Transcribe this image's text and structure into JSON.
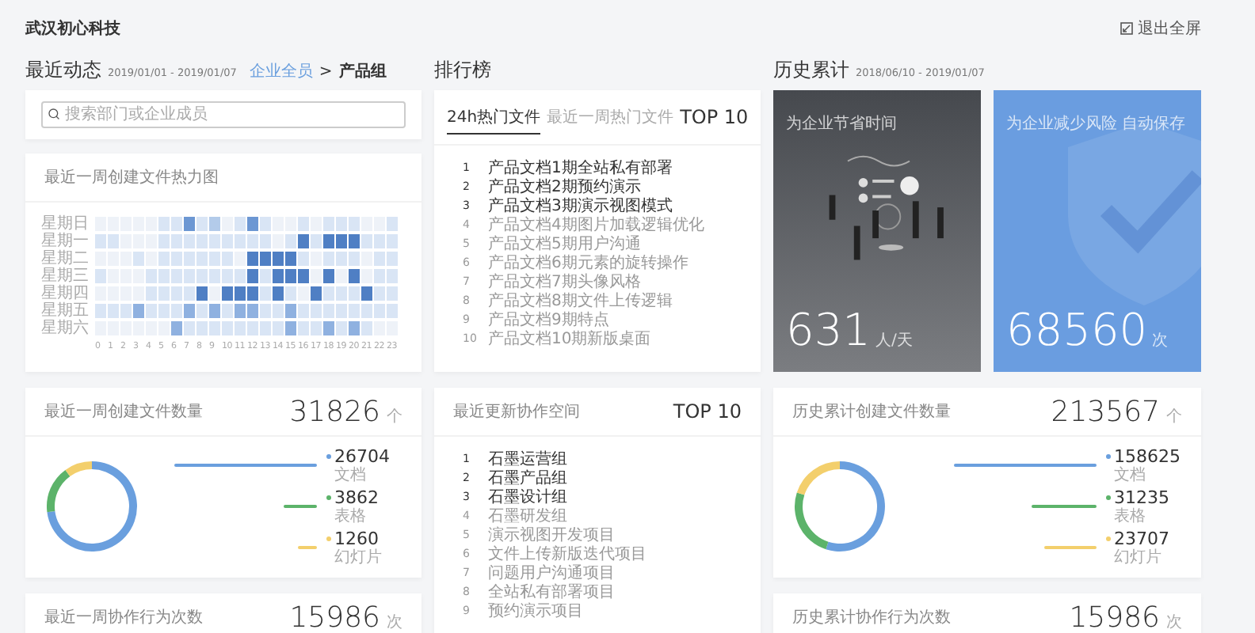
{
  "header": {
    "brand": "武汉初心科技",
    "exit_button": "退出全屏"
  },
  "recent": {
    "title": "最近动态",
    "date_range": "2019/01/01 - 2019/01/07",
    "breadcrumb": [
      {
        "label": "企业全员",
        "kind": "link"
      },
      {
        "label": ">",
        "kind": "separator"
      },
      {
        "label": "产品组",
        "kind": "current"
      }
    ],
    "search": {
      "placeholder": "搜索部门或企业成员"
    },
    "heatmap": {
      "title": "最近一周创建文件热力图",
      "hours": [
        "0",
        "1",
        "2",
        "3",
        "4",
        "5",
        "6",
        "7",
        "8",
        "9",
        "10",
        "11",
        "12",
        "13",
        "14",
        "15",
        "16",
        "17",
        "18",
        "19",
        "20",
        "21",
        "22",
        "23"
      ],
      "rows": [
        {
          "label": "星期日",
          "cells": [
            {
              "color": "#eef2f8"
            },
            {
              "color": "#eef2f8"
            },
            {
              "color": "#eef2f8"
            },
            {
              "color": "#eef2f8"
            },
            {
              "color": "#eef2f8"
            },
            {
              "color": "#d9e5f5"
            },
            {
              "color": "#d9e5f5"
            },
            {
              "color": "#6c97d3"
            },
            {
              "color": "#d9e5f5"
            },
            {
              "color": "#b3cbea"
            },
            {
              "color": "#eef2f8"
            },
            {
              "color": "#d9e5f5"
            },
            {
              "color": "#6c97d3"
            },
            {
              "color": "#d9e5f5"
            },
            {
              "color": "#eef2f8"
            },
            {
              "color": "#eef2f8"
            },
            {
              "color": "#d9e5f5"
            },
            {
              "color": "#eef2f8"
            },
            {
              "color": "#d9e5f5"
            },
            {
              "color": "#d9e5f5"
            },
            {
              "color": "#d9e5f5"
            },
            {
              "color": "#eef2f8"
            },
            {
              "color": "#eef2f8"
            },
            {
              "color": "#d9e5f5"
            }
          ]
        },
        {
          "label": "星期一",
          "cells": [
            {
              "color": "#d9e5f5"
            },
            {
              "color": "#d9e5f5"
            },
            {
              "color": "#eef2f8"
            },
            {
              "color": "#eef2f8"
            },
            {
              "color": "#eef2f8"
            },
            {
              "color": "#d9e5f5"
            },
            {
              "color": "#d9e5f5"
            },
            {
              "color": "#d9e5f5"
            },
            {
              "color": "#d9e5f5"
            },
            {
              "color": "#d9e5f5"
            },
            {
              "color": "#d9e5f5"
            },
            {
              "color": "#d9e5f5"
            },
            {
              "color": "#d9e5f5"
            },
            {
              "color": "#d9e5f5"
            },
            {
              "color": "#eef2f8"
            },
            {
              "color": "#d9e5f5"
            },
            {
              "color": "#4f7fc4"
            },
            {
              "color": "#d9e5f5"
            },
            {
              "color": "#4f7fc4"
            },
            {
              "color": "#4f7fc4"
            },
            {
              "color": "#4f7fc4"
            },
            {
              "color": "#d9e5f5"
            },
            {
              "color": "#d9e5f5"
            },
            {
              "color": "#d9e5f5"
            }
          ]
        },
        {
          "label": "星期二",
          "cells": [
            {
              "color": "#eef2f8"
            },
            {
              "color": "#eef2f8"
            },
            {
              "color": "#eef2f8"
            },
            {
              "color": "#d9e5f5"
            },
            {
              "color": "#eef2f8"
            },
            {
              "color": "#d9e5f5"
            },
            {
              "color": "#d9e5f5"
            },
            {
              "color": "#d9e5f5"
            },
            {
              "color": "#d9e5f5"
            },
            {
              "color": "#d9e5f5"
            },
            {
              "color": "#d9e5f5"
            },
            {
              "color": "#eef2f8"
            },
            {
              "color": "#4f7fc4"
            },
            {
              "color": "#4f7fc4"
            },
            {
              "color": "#4f7fc4"
            },
            {
              "color": "#4f7fc4"
            },
            {
              "color": "#d9e5f5"
            },
            {
              "color": "#eef2f8"
            },
            {
              "color": "#d9e5f5"
            },
            {
              "color": "#d9e5f5"
            },
            {
              "color": "#d9e5f5"
            },
            {
              "color": "#eef2f8"
            },
            {
              "color": "#d9e5f5"
            },
            {
              "color": "#d9e5f5"
            }
          ]
        },
        {
          "label": "星期三",
          "cells": [
            {
              "color": "#d9e5f5"
            },
            {
              "color": "#eef2f8"
            },
            {
              "color": "#eef2f8"
            },
            {
              "color": "#eef2f8"
            },
            {
              "color": "#d9e5f5"
            },
            {
              "color": "#d9e5f5"
            },
            {
              "color": "#d9e5f5"
            },
            {
              "color": "#d9e5f5"
            },
            {
              "color": "#d9e5f5"
            },
            {
              "color": "#d9e5f5"
            },
            {
              "color": "#d9e5f5"
            },
            {
              "color": "#d9e5f5"
            },
            {
              "color": "#4f7fc4"
            },
            {
              "color": "#d9e5f5"
            },
            {
              "color": "#4f7fc4"
            },
            {
              "color": "#4f7fc4"
            },
            {
              "color": "#4f7fc4"
            },
            {
              "color": "#eef2f8"
            },
            {
              "color": "#4f7fc4"
            },
            {
              "color": "#eef2f8"
            },
            {
              "color": "#4f7fc4"
            },
            {
              "color": "#eef2f8"
            },
            {
              "color": "#d9e5f5"
            },
            {
              "color": "#d9e5f5"
            }
          ]
        },
        {
          "label": "星期四",
          "cells": [
            {
              "color": "#eef2f8"
            },
            {
              "color": "#eef2f8"
            },
            {
              "color": "#eef2f8"
            },
            {
              "color": "#eef2f8"
            },
            {
              "color": "#d9e5f5"
            },
            {
              "color": "#d9e5f5"
            },
            {
              "color": "#d9e5f5"
            },
            {
              "color": "#d9e5f5"
            },
            {
              "color": "#4f7fc4"
            },
            {
              "color": "#eef2f8"
            },
            {
              "color": "#4f7fc4"
            },
            {
              "color": "#4f7fc4"
            },
            {
              "color": "#4f7fc4"
            },
            {
              "color": "#d9e5f5"
            },
            {
              "color": "#4f7fc4"
            },
            {
              "color": "#d9e5f5"
            },
            {
              "color": "#eef2f8"
            },
            {
              "color": "#4f7fc4"
            },
            {
              "color": "#d9e5f5"
            },
            {
              "color": "#d9e5f5"
            },
            {
              "color": "#d9e5f5"
            },
            {
              "color": "#4f7fc4"
            },
            {
              "color": "#d9e5f5"
            },
            {
              "color": "#d9e5f5"
            }
          ]
        },
        {
          "label": "星期五",
          "cells": [
            {
              "color": "#d9e5f5"
            },
            {
              "color": "#d9e5f5"
            },
            {
              "color": "#d9e5f5"
            },
            {
              "color": "#8fb1e0"
            },
            {
              "color": "#d9e5f5"
            },
            {
              "color": "#d9e5f5"
            },
            {
              "color": "#d9e5f5"
            },
            {
              "color": "#8fb1e0"
            },
            {
              "color": "#d9e5f5"
            },
            {
              "color": "#8fb1e0"
            },
            {
              "color": "#d9e5f5"
            },
            {
              "color": "#8fb1e0"
            },
            {
              "color": "#8fb1e0"
            },
            {
              "color": "#d9e5f5"
            },
            {
              "color": "#d9e5f5"
            },
            {
              "color": "#8fb1e0"
            },
            {
              "color": "#d9e5f5"
            },
            {
              "color": "#d9e5f5"
            },
            {
              "color": "#d9e5f5"
            },
            {
              "color": "#d9e5f5"
            },
            {
              "color": "#d9e5f5"
            },
            {
              "color": "#d9e5f5"
            },
            {
              "color": "#d9e5f5"
            },
            {
              "color": "#d9e5f5"
            }
          ]
        },
        {
          "label": "星期六",
          "cells": [
            {
              "color": "#eef2f8"
            },
            {
              "color": "#eef2f8"
            },
            {
              "color": "#eef2f8"
            },
            {
              "color": "#eef2f8"
            },
            {
              "color": "#eef2f8"
            },
            {
              "color": "#eef2f8"
            },
            {
              "color": "#8fb1e0"
            },
            {
              "color": "#d9e5f5"
            },
            {
              "color": "#d9e5f5"
            },
            {
              "color": "#d9e5f5"
            },
            {
              "color": "#d9e5f5"
            },
            {
              "color": "#d9e5f5"
            },
            {
              "color": "#d9e5f5"
            },
            {
              "color": "#d9e5f5"
            },
            {
              "color": "#d9e5f5"
            },
            {
              "color": "#8fb1e0"
            },
            {
              "color": "#d9e5f5"
            },
            {
              "color": "#d9e5f5"
            },
            {
              "color": "#8fb1e0"
            },
            {
              "color": "#d9e5f5"
            },
            {
              "color": "#8fb1e0"
            },
            {
              "color": "#d9e5f5"
            },
            {
              "color": "#eef2f8"
            },
            {
              "color": "#eef2f8"
            }
          ]
        }
      ]
    },
    "files": {
      "title": "最近一周创建文件数量",
      "total": "31826",
      "unit": "个",
      "legend": [
        {
          "value": "26704",
          "color": "#6a9fde"
        },
        {
          "value": "3862",
          "color": "#5cb36a"
        },
        {
          "value": "1260",
          "color": "#f3cf6c"
        }
      ],
      "chart_data": {
        "type": "donut",
        "categories": [
          "文档",
          "表格",
          "幻灯片"
        ],
        "series": [
          {
            "values": [
              73,
              17,
              10
            ]
          }
        ]
      }
    },
    "actions": {
      "title": "最近一周协作行为次数",
      "total": "15986",
      "unit": "次"
    }
  },
  "ranking": {
    "title": "排行榜",
    "top_label": "TOP 10",
    "tabs": [
      {
        "label": "24h热门文件",
        "selected": true
      },
      {
        "label": "最近一周热门文件",
        "selected": false
      }
    ],
    "items": [
      {
        "rank": "1",
        "name": "产品文档1期全站私有部署",
        "highlighted": true
      },
      {
        "rank": "2",
        "name": "产品文档2期预约演示",
        "highlighted": true
      },
      {
        "rank": "3",
        "name": "产品文档3期演示视图模式",
        "highlighted": true
      },
      {
        "rank": "4",
        "name": "产品文档4期图片加载逻辑优化",
        "highlighted": false
      },
      {
        "rank": "5",
        "name": "产品文档5期用户沟通",
        "highlighted": false
      },
      {
        "rank": "6",
        "name": "产品文档6期元素的旋转操作",
        "highlighted": false
      },
      {
        "rank": "7",
        "name": "产品文档7期头像风格",
        "highlighted": false
      },
      {
        "rank": "8",
        "name": "产品文档8期文件上传逻辑",
        "highlighted": false
      },
      {
        "rank": "9",
        "name": "产品文档9期特点",
        "highlighted": false
      },
      {
        "rank": "10",
        "name": "产品文档10期新版桌面",
        "highlighted": false
      }
    ],
    "spaces": {
      "title": "最近更新协作空间",
      "top_label": "TOP 10",
      "items": [
        {
          "rank": "1",
          "name": "石墨运营组",
          "highlighted": true
        },
        {
          "rank": "2",
          "name": "石墨产品组",
          "highlighted": true
        },
        {
          "rank": "3",
          "name": "石墨设计组",
          "highlighted": true
        },
        {
          "rank": "4",
          "name": "石墨研发组",
          "highlighted": false
        },
        {
          "rank": "5",
          "name": "演示视图开发项目",
          "highlighted": false
        },
        {
          "rank": "6",
          "name": "文件上传新版迭代项目",
          "highlighted": false
        },
        {
          "rank": "7",
          "name": "问题用户沟通项目",
          "highlighted": false
        },
        {
          "rank": "8",
          "name": "全站私有部署项目",
          "highlighted": false
        },
        {
          "rank": "9",
          "name": "预约演示项目",
          "highlighted": false
        }
      ]
    }
  },
  "history": {
    "title": "历史累计",
    "date_range": "2018/06/10 - 2019/01/07",
    "highlights": [
      {
        "kind": "picture",
        "title": "为企业节省时间",
        "value": "631",
        "unit": "人/天"
      },
      {
        "kind": "shield",
        "title": "为企业减少风险 自动保存",
        "value": "68560",
        "unit": "次"
      }
    ],
    "files": {
      "title": "历史累计创建文件数量",
      "total": "213567",
      "unit": "个",
      "legend": [
        {
          "value": "158625",
          "color": "#6a9fde"
        },
        {
          "value": "31235",
          "color": "#5cb36a"
        },
        {
          "value": "23707",
          "color": "#f3cf6c"
        }
      ],
      "chart_data": {
        "type": "donut",
        "categories": [
          "文档",
          "表格",
          "幻灯片"
        ],
        "series": [
          {
            "values": [
              55,
              25,
              20
            ]
          }
        ]
      }
    },
    "actions": {
      "title": "历史累计协作行为次数",
      "total": "15986",
      "unit": "次"
    }
  }
}
